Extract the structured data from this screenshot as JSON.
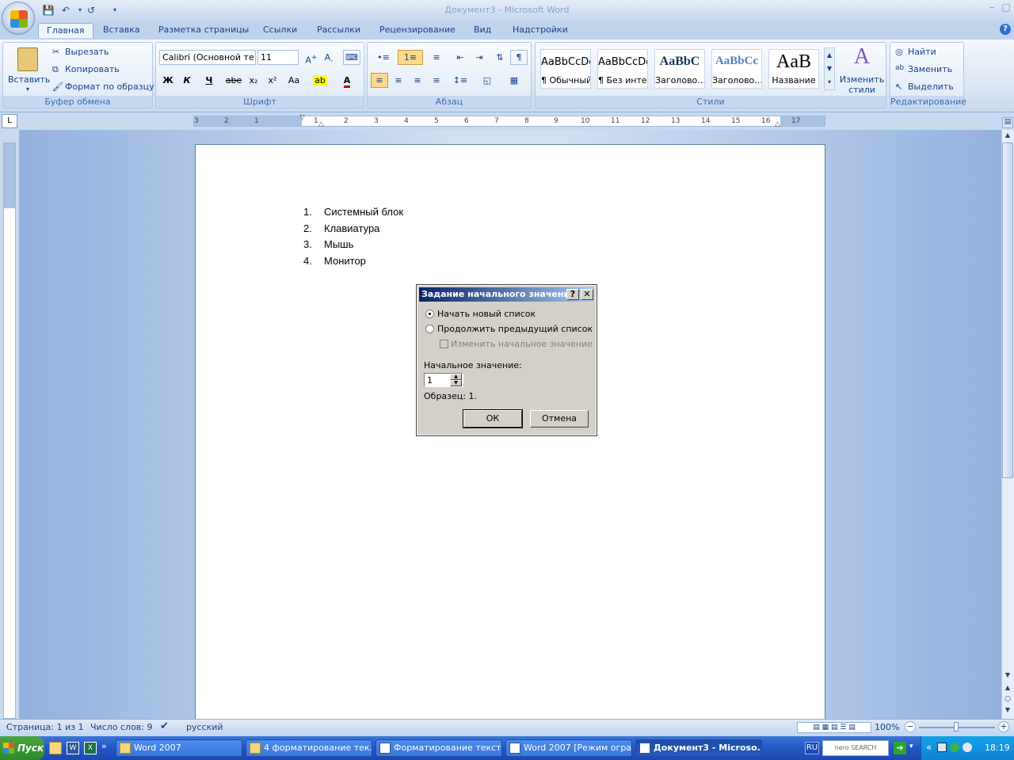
{
  "window": {
    "title": "Документ3 - Microsoft Word"
  },
  "tabs": [
    "Главная",
    "Вставка",
    "Разметка страницы",
    "Ссылки",
    "Рассылки",
    "Рецензирование",
    "Вид",
    "Надстройки"
  ],
  "clipboard": {
    "paste": "Вставить",
    "cut": "Вырезать",
    "copy": "Копировать",
    "format_painter": "Формат по образцу",
    "label": "Буфер обмена"
  },
  "font": {
    "name": "Calibri (Основной те",
    "size": "11",
    "label": "Шрифт",
    "bold": "Ж",
    "italic": "К",
    "underline": "Ч",
    "strike": "abe",
    "sub": "x₂",
    "sup": "x²",
    "case": "Aa"
  },
  "paragraph": {
    "label": "Абзац"
  },
  "styles": {
    "label": "Стили",
    "items": [
      {
        "sample": "AaBbCcDc",
        "name": "¶ Обычный"
      },
      {
        "sample": "AaBbCcDc",
        "name": "¶ Без инте..."
      },
      {
        "sample": "AaBbC",
        "name": "Заголово..."
      },
      {
        "sample": "AaBbCc",
        "name": "Заголово..."
      },
      {
        "sample": "AaB",
        "name": "Название"
      }
    ],
    "change": "Изменить стили"
  },
  "editing": {
    "find": "Найти",
    "replace": "Заменить",
    "select": "Выделить",
    "label": "Редактирование"
  },
  "document": {
    "list": [
      {
        "num": "1.",
        "text": "Системный блок"
      },
      {
        "num": "2.",
        "text": "Клавиатура"
      },
      {
        "num": "3.",
        "text": "Мышь"
      },
      {
        "num": "4.",
        "text": "Монитор"
      }
    ]
  },
  "dialog": {
    "title": "Задание начального значения",
    "option_new": "Начать новый список",
    "option_continue": "Продолжить предыдущий список",
    "option_change": "Изменить начальное значение",
    "start_label": "Начальное значение:",
    "start_value": "1",
    "sample": "Образец: 1.",
    "ok": "ОК",
    "cancel": "Отмена"
  },
  "ruler_numbers": [
    "3",
    "2",
    "1",
    "1",
    "2",
    "3",
    "4",
    "5",
    "6",
    "7",
    "8",
    "9",
    "10",
    "11",
    "12",
    "13",
    "14",
    "15",
    "16",
    "17"
  ],
  "status": {
    "page": "Страница: 1 из 1",
    "words": "Число слов: 9",
    "lang": "русский",
    "zoom": "100%"
  },
  "taskbar": {
    "start": "Пуск",
    "items": [
      "Word 2007",
      "4 форматирование тек...",
      "Форматирование текст...",
      "Word 2007 [Режим огра...",
      "Документ3 - Microso..."
    ],
    "lang": "RU",
    "search": "nero SEARCH",
    "time": "18:19"
  }
}
